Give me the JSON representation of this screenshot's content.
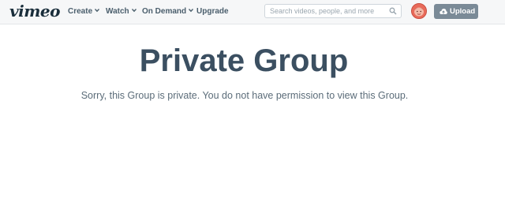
{
  "header": {
    "logo_text": "vimeo",
    "nav": [
      {
        "label": "Create",
        "has_dropdown": true
      },
      {
        "label": "Watch",
        "has_dropdown": true
      },
      {
        "label": "On Demand",
        "has_dropdown": true
      },
      {
        "label": "Upgrade",
        "has_dropdown": false
      }
    ],
    "search": {
      "placeholder": "Search videos, people, and more",
      "value": ""
    },
    "upload_label": "Upload",
    "colors": {
      "brand": "#1a2e3b",
      "upload_button": "#7a8a97",
      "avatar": "#e86a5a"
    }
  },
  "main": {
    "title": "Private Group",
    "message": "Sorry, this Group is private. You do not have permission to view this Group."
  }
}
